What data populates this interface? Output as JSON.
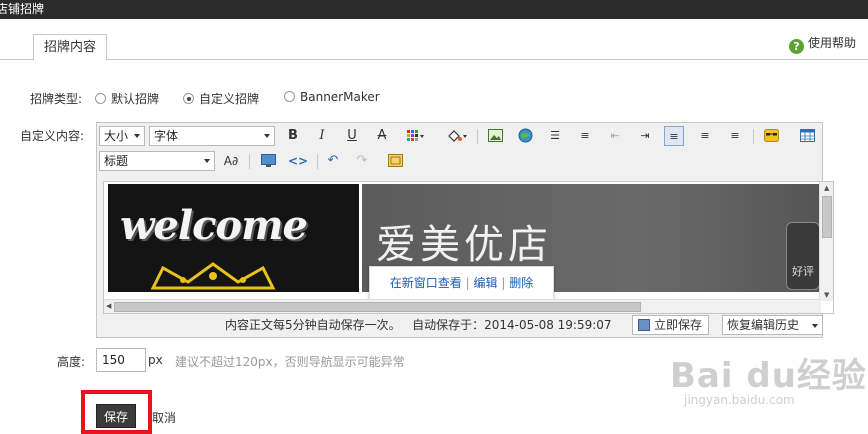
{
  "window": {
    "title": "店铺招牌"
  },
  "tab": {
    "label": "招牌内容"
  },
  "help": {
    "label": "使用帮助"
  },
  "form": {
    "type_label": "招牌类型:",
    "options": [
      {
        "label": "默认招牌",
        "selected": false
      },
      {
        "label": "自定义招牌",
        "selected": true
      },
      {
        "label": "BannerMaker",
        "selected": false
      }
    ],
    "content_label": "自定义内容:",
    "height_label": "高度:",
    "height_value": "150",
    "height_unit": "px",
    "height_hint": "建议不超过120px，否则导航显示可能异常",
    "save_label": "保存",
    "cancel_label": "取消"
  },
  "editor": {
    "size_select": "大小",
    "font_select": "字体",
    "heading_select": "标题",
    "preview": {
      "welcome_text": "welcome",
      "shop_text": "爱美优店",
      "badge_text": "好评"
    },
    "popup": {
      "open": "在新窗口查看",
      "sep": "|",
      "edit": "编辑",
      "delete": "删除"
    },
    "status": {
      "autosave_note": "内容正文每5分钟自动保存一次。",
      "autosave_label": "自动保存于：",
      "autosave_time": "2014-05-08 19:59:07",
      "save_now": "立即保存",
      "restore": "恢复编辑历史"
    }
  },
  "watermark": {
    "brand": "Bai  du经验",
    "url": "jingyan.baidu.com"
  },
  "colors": {
    "highlight": "#e8141c",
    "link": "#1a5cb5",
    "help_green": "#5aa531"
  }
}
